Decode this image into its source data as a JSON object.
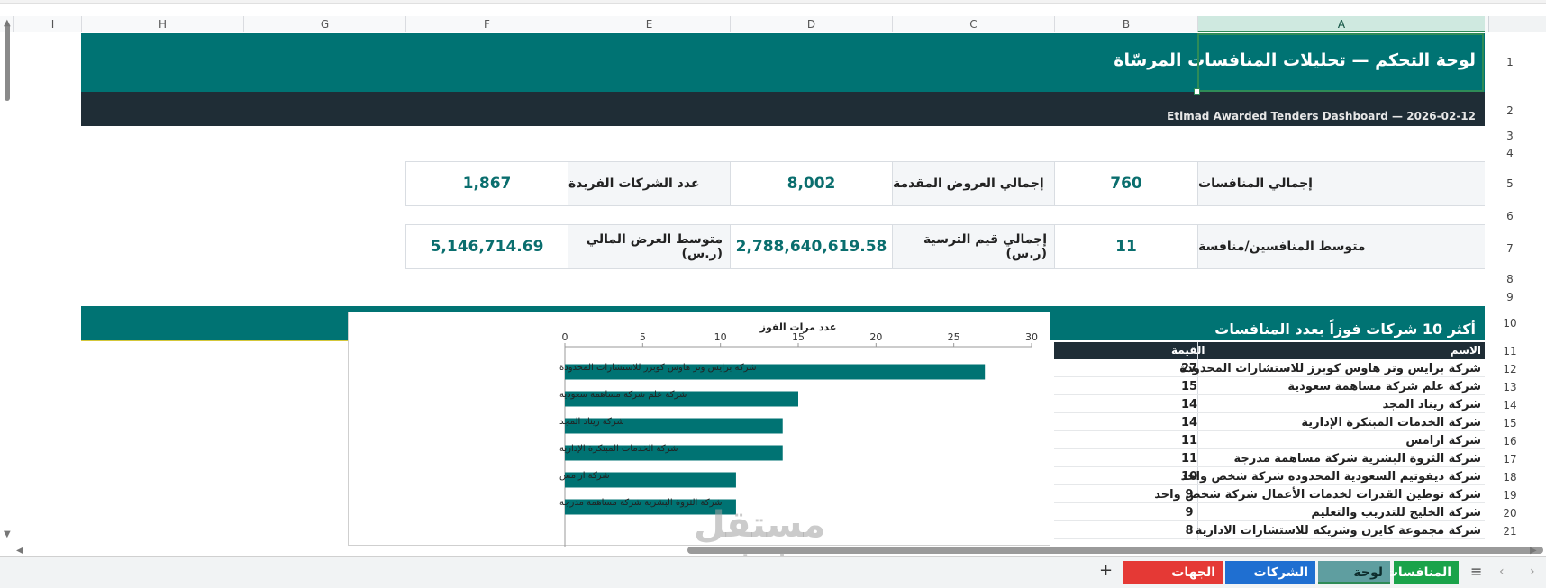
{
  "columns": [
    "A",
    "B",
    "C",
    "D",
    "E",
    "F",
    "G",
    "H",
    "I"
  ],
  "rows": [
    "1",
    "2",
    "3",
    "4",
    "5",
    "6",
    "7",
    "8",
    "9",
    "10",
    "11",
    "12",
    "13",
    "14",
    "15",
    "16",
    "17",
    "18",
    "19",
    "20",
    "21"
  ],
  "banner": {
    "title": "لوحة التحكم — تحليلات المنافسات المرسّاة",
    "subtitle": "Etimad Awarded Tenders Dashboard  —  2026-02-12"
  },
  "kpi_row1": {
    "label_a": "إجمالي المنافسات",
    "value_b": "760",
    "label_c": "إجمالي العروض المقدمة",
    "value_d": "8,002",
    "label_e": "عدد الشركات الفريدة",
    "value_f": "1,867"
  },
  "kpi_row2": {
    "label_a": "متوسط المنافسين/منافسة",
    "value_b": "11",
    "label_c": "إجمالي قيم الترسية (ر.س)",
    "value_d": "2,788,640,619.58",
    "label_e": "متوسط العرض المالي (ر.س)",
    "value_f": "5,146,714.69"
  },
  "section": {
    "title": "أكثر 10 شركات فوزاً بعدد المنافسات"
  },
  "table": {
    "header_name": "الاسم",
    "header_value": "القيمة",
    "rows": [
      {
        "name": "شركة برايس وتر هاوس كوبرز للاستشارات المحدودة",
        "value": "27"
      },
      {
        "name": "شركة علم شركة مساهمة سعودية",
        "value": "15"
      },
      {
        "name": "شركة ريناد المجد",
        "value": "14"
      },
      {
        "name": "شركة الخدمات المبتكرة الإدارية",
        "value": "14"
      },
      {
        "name": "شركة ارامس",
        "value": "11"
      },
      {
        "name": "شركة الثروة البشرية شركة مساهمة مدرجة",
        "value": "11"
      },
      {
        "name": "شركة ديفوتيم السعودية المحدوده شركة شخص واحد",
        "value": "10"
      },
      {
        "name": "شركة توطين القدرات لخدمات الأعمال شركة شخص واحد",
        "value": "9"
      },
      {
        "name": "شركة الخليج للتدريب والتعليم",
        "value": "9"
      },
      {
        "name": "شركة مجموعة كايزن وشريكه للاستشارات الادارية",
        "value": "8"
      }
    ]
  },
  "chart_data": {
    "type": "bar",
    "orientation": "horizontal",
    "title": "عدد مرات الفوز",
    "xlim": [
      0,
      30
    ],
    "ticks": [
      0,
      5,
      10,
      15,
      20,
      25,
      30
    ],
    "categories": [
      "شركة برايس وتر هاوس كوبرز للاستشارات المحدودة",
      "شركة علم شركة مساهمة سعودية",
      "شركة ريناد المجد",
      "شركة الخدمات المبتكرة الإدارية",
      "شركة ارامس",
      "شركة الثروة البشرية شركة مساهمة مدرجة"
    ],
    "values": [
      27,
      15,
      14,
      14,
      11,
      11
    ],
    "color": "#007373"
  },
  "tabs": {
    "competitions": "المنافسات",
    "dashboard": "لوحة التحكم",
    "winners": "الشركات الفائزة",
    "gov": "الجهات الحكومية"
  },
  "watermark": {
    "ar": "مستقل",
    "en": "mostaql.com"
  }
}
